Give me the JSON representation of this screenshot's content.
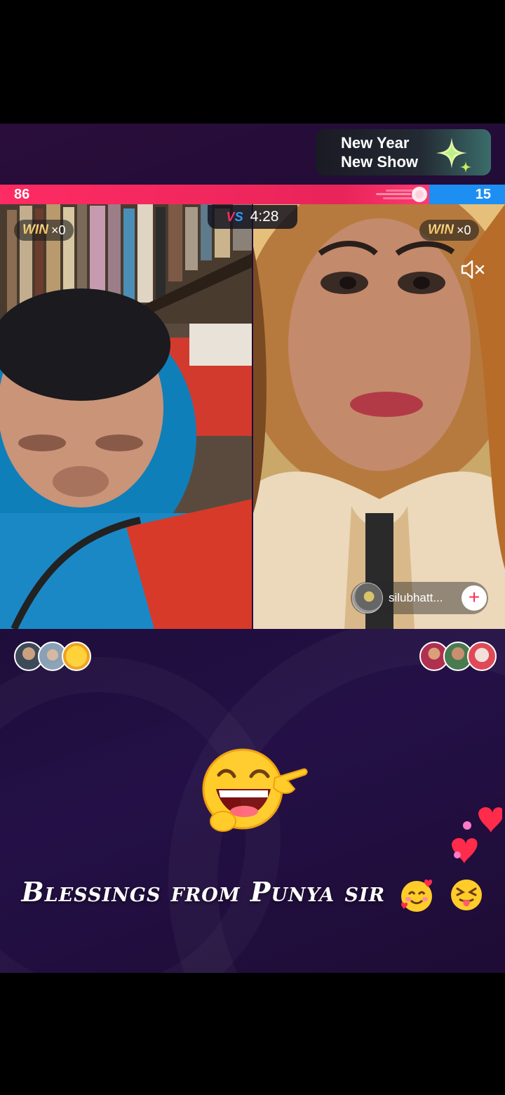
{
  "banner": {
    "line1": "New Year",
    "line2": "New Show"
  },
  "battle": {
    "left_score": "86",
    "right_score": "15",
    "left_share": 0.85,
    "timer": "4:28",
    "vs_v": "V",
    "vs_s": "S",
    "left_win_label": "WIN",
    "left_win_count": "×0",
    "right_win_label": "WIN",
    "right_win_count": "×0"
  },
  "right_host": {
    "name": "silubhatt...",
    "follow_label": "+"
  },
  "caption": {
    "text": "Blessings from Punya sir"
  },
  "colors": {
    "red_team": "#ff2b63",
    "blue_team": "#1e8ff2"
  },
  "icons": [
    "sparkle-icon",
    "mute-icon",
    "laughing-pointing-emoji",
    "hearts-icon",
    "smiling-hearts-emoji",
    "tongue-out-emoji"
  ]
}
